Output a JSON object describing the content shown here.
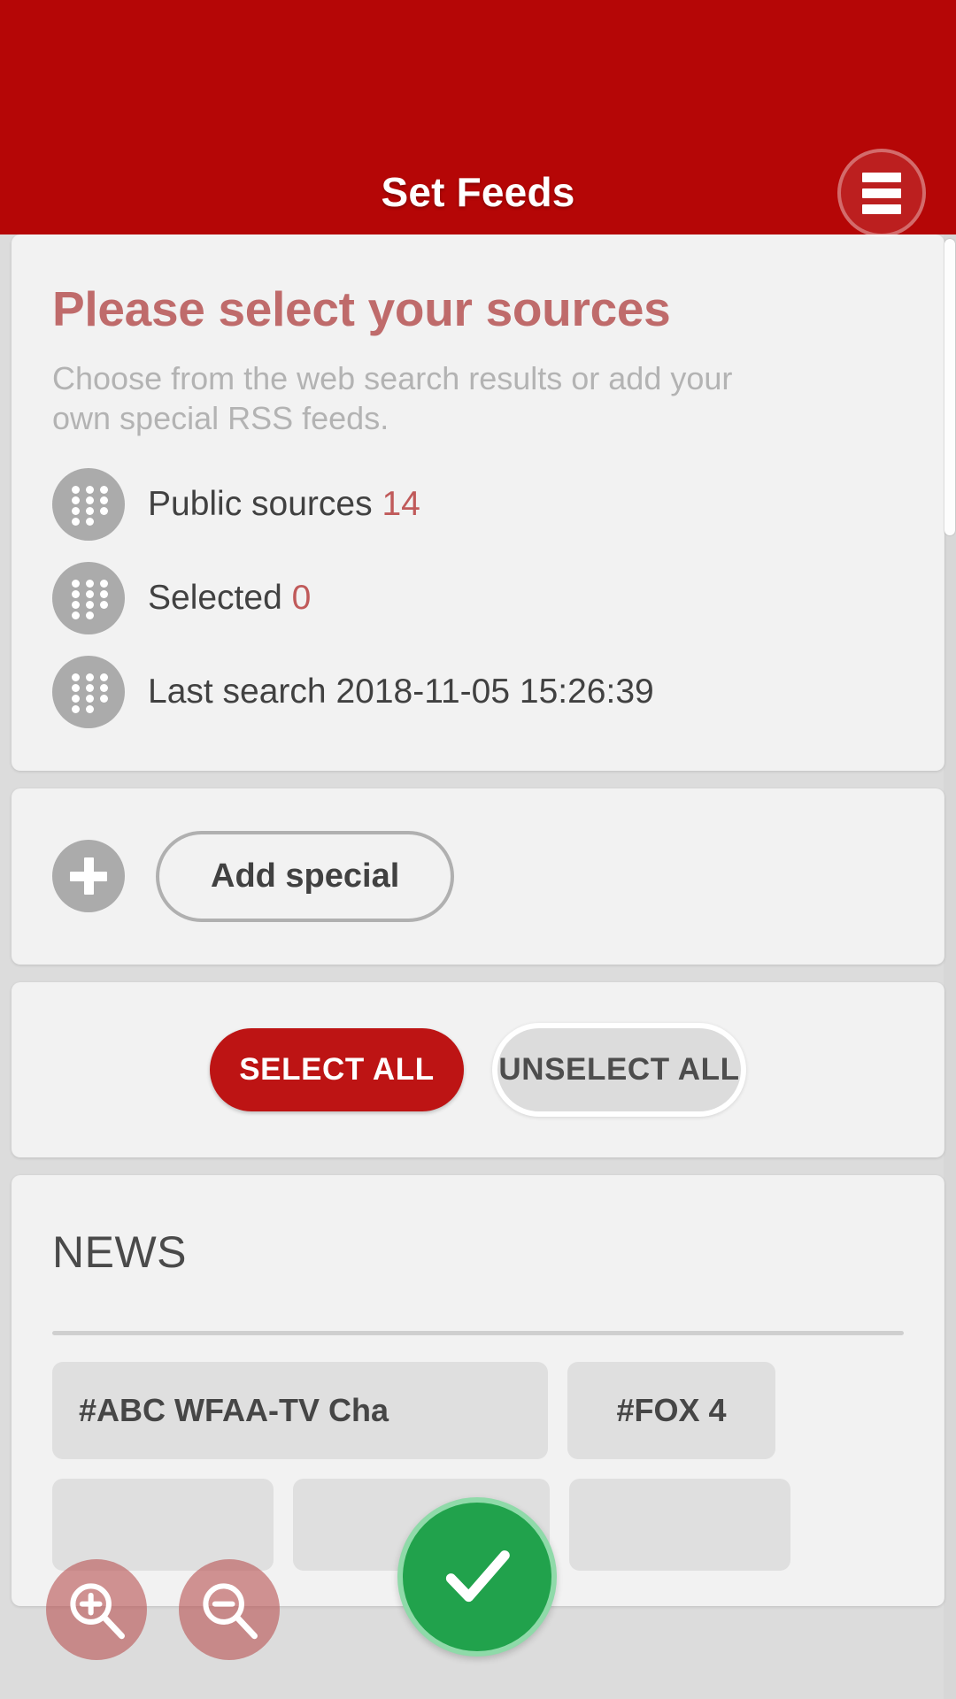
{
  "header": {
    "title": "Set Feeds",
    "menu_icon": "hamburger-menu-icon",
    "background_color": "#b50606"
  },
  "sources_card": {
    "heading": "Please select your sources",
    "subtext": "Choose from the web search results or add your own special RSS feeds.",
    "heading_color": "#bf6b6b",
    "info_rows": [
      {
        "icon": "dots-grid-icon",
        "label": "Public sources",
        "value": "14"
      },
      {
        "icon": "dots-grid-icon",
        "label": "Selected",
        "value": "0"
      },
      {
        "icon": "dots-grid-icon",
        "label": "Last search",
        "value": "2018-11-05 15:26:39"
      }
    ]
  },
  "add_card": {
    "icon": "plus-circle-icon",
    "button_label": "Add special"
  },
  "select_card": {
    "select_all_label": "SELECT ALL",
    "unselect_all_label": "UNSELECT ALL",
    "select_all_color": "#bd1414"
  },
  "news_card": {
    "section_title": "NEWS",
    "chips": [
      {
        "label": "#ABC WFAA-TV Cha"
      },
      {
        "label": "#FOX 4"
      }
    ],
    "chips_row2": [
      {
        "label": ""
      },
      {
        "label": ""
      },
      {
        "label": ""
      }
    ]
  },
  "floating_controls": {
    "zoom_in_icon": "magnifier-plus-icon",
    "zoom_out_icon": "magnifier-minus-icon",
    "confirm_icon": "check-icon",
    "confirm_color": "#21a24c"
  }
}
